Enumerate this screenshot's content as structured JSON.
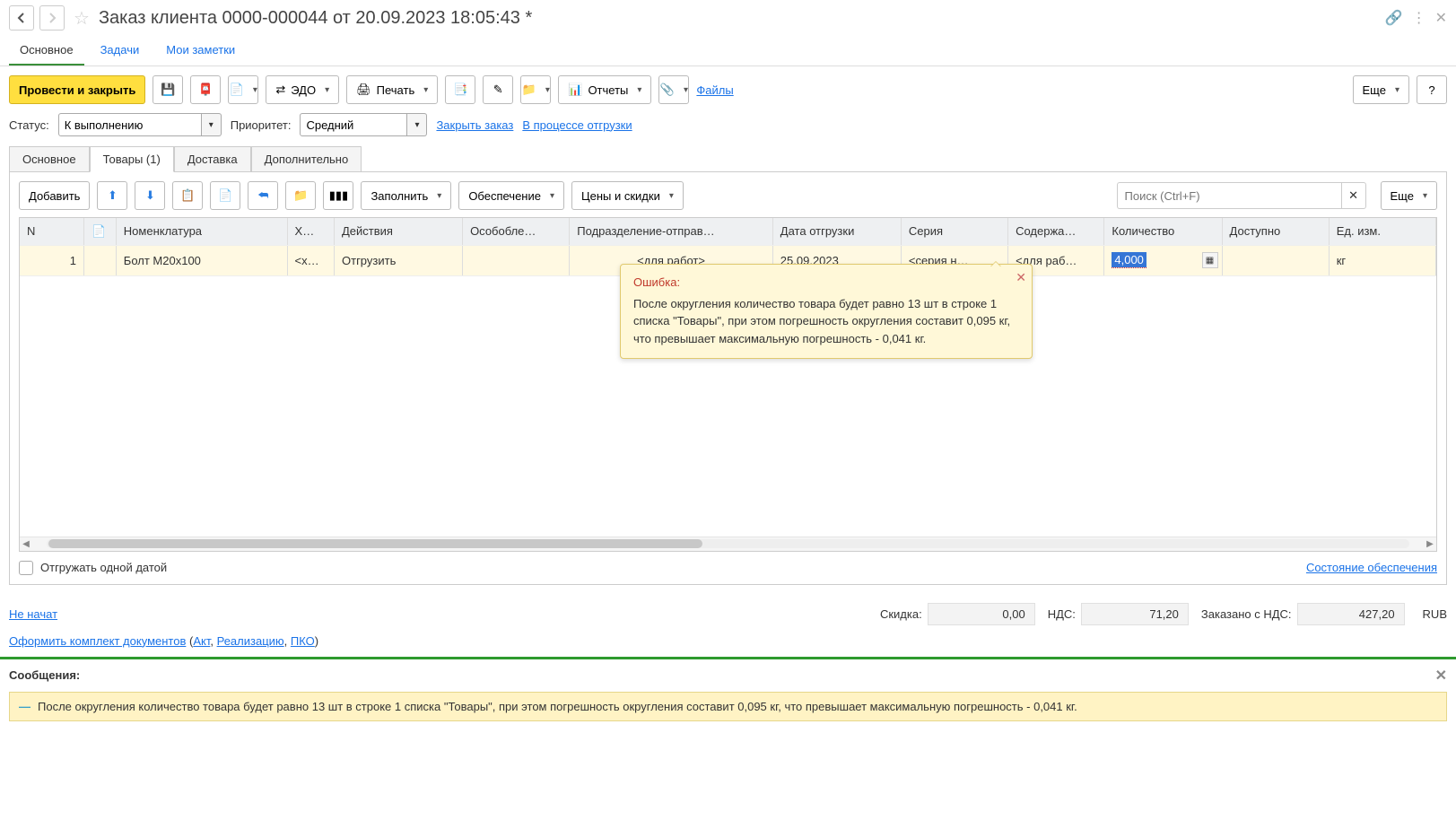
{
  "header": {
    "title": "Заказ клиента 0000-000044 от 20.09.2023 18:05:43 *"
  },
  "navTabs": {
    "main": "Основное",
    "tasks": "Задачи",
    "notes": "Мои заметки"
  },
  "toolbar": {
    "postClose": "Провести и закрыть",
    "edo": "ЭДО",
    "print": "Печать",
    "reports": "Отчеты",
    "files": "Файлы",
    "more": "Еще"
  },
  "statusRow": {
    "statusLabel": "Статус:",
    "statusValue": "К выполнению",
    "priorityLabel": "Приоритет:",
    "priorityValue": "Средний",
    "closeOrder": "Закрыть заказ",
    "inShipping": "В процессе отгрузки"
  },
  "innerTabs": {
    "main": "Основное",
    "goods": "Товары (1)",
    "delivery": "Доставка",
    "extra": "Дополнительно"
  },
  "tblToolbar": {
    "add": "Добавить",
    "fill": "Заполнить",
    "supply": "Обеспечение",
    "prices": "Цены и скидки",
    "searchPH": "Поиск (Ctrl+F)",
    "more": "Еще"
  },
  "cols": {
    "n": "N",
    "nomen": "Номенклатура",
    "char": "Х…",
    "actions": "Действия",
    "osob": "Особобле…",
    "dept": "Подразделение-отправ…",
    "shipDate": "Дата отгрузки",
    "series": "Серия",
    "content": "Содержа…",
    "qty": "Количество",
    "avail": "Доступно",
    "unit": "Ед. изм."
  },
  "row": {
    "n": "1",
    "nomen": "Болт М20х100",
    "char": "<х…",
    "action": "Отгрузить",
    "deptPH": "<для работ>",
    "shipDate": "25.09.2023",
    "seriesPH": "<серия н…",
    "contentPH": "<для раб…",
    "qty": "4,000",
    "unit": "кг"
  },
  "errbox": {
    "title": "Ошибка:",
    "text": "После округления количество товара будет равно 13 шт в строке 1 списка \"Товары\", при этом погрешность округления составит 0,095 кг, что превышает максимальную погрешность - 0,041 кг."
  },
  "cardFooter": {
    "singleDate": "Отгружать одной датой",
    "supplyState": "Состояние обеспечения"
  },
  "totals": {
    "notStarted": "Не начат",
    "discountLabel": "Скидка:",
    "discountVal": "0,00",
    "vatLabel": "НДС:",
    "vatVal": "71,20",
    "orderedLabel": "Заказано с НДС:",
    "orderedVal": "427,20",
    "currency": "RUB"
  },
  "docLinks": {
    "prefix": "Оформить комплект документов",
    "act": "Акт",
    "realization": "Реализацию",
    "pko": "ПКО"
  },
  "messages": {
    "title": "Сообщения:",
    "text": "После округления количество товара будет равно 13 шт в строке 1 списка \"Товары\", при этом погрешность округления составит 0,095 кг, что превышает максимальную погрешность - 0,041 кг."
  }
}
